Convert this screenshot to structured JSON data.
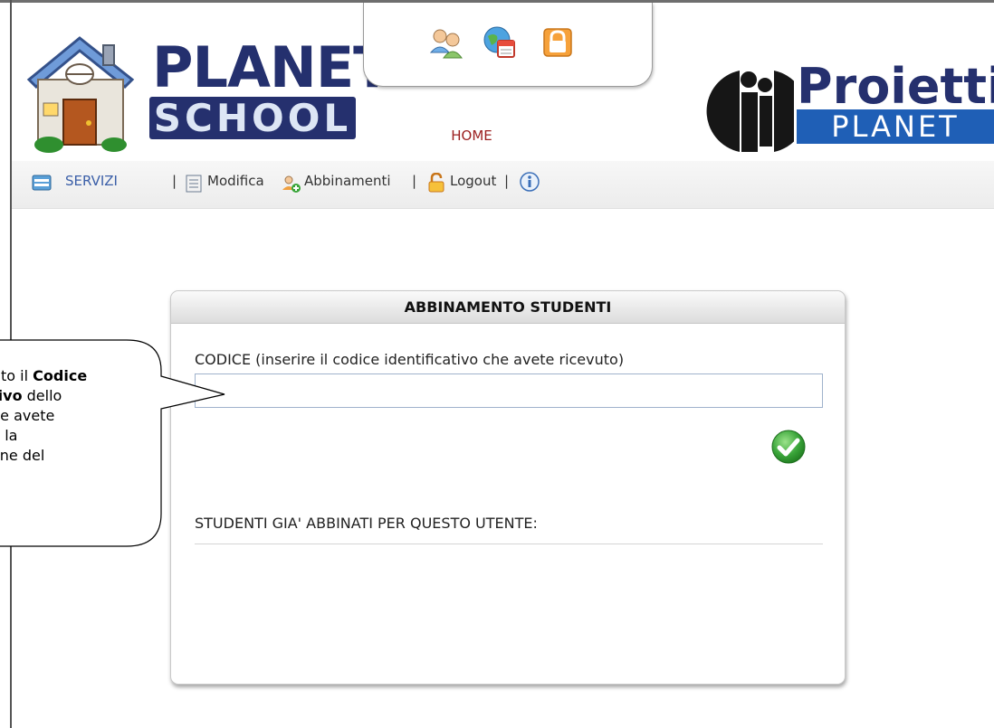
{
  "header": {
    "logo_line1": "PLANET",
    "logo_line2": "SCHOOL",
    "home_label": "HOME",
    "brand_name": "Proietti",
    "brand_sub": "PLANET",
    "top_icons": [
      "users-icon",
      "calendar-globe-icon",
      "lock-icon"
    ]
  },
  "toolbar": {
    "servizi_label": "SERVIZI",
    "sep1": "|",
    "modifica_label": "Modifica",
    "abbinamenti_label": "Abbinamenti",
    "sep2": "|",
    "logout_label": "Logout",
    "sep3": "|"
  },
  "panel": {
    "title": "ABBINAMENTO STUDENTI",
    "code_label": "CODICE (inserire il codice identificativo che avete ricevuto)",
    "code_value": "",
    "associated_label": "STUDENTI GIA' ABBINATI PER QUESTO UTENTE:",
    "associated_items": []
  },
  "callout": {
    "line1_pre": "rito il ",
    "line1_bold": "Codice",
    "line2_bold": "tivo",
    "line2_post": " dello",
    "line3": "he avete",
    "line4": "n la",
    "line5": "one del"
  },
  "colors": {
    "brand_navy": "#25306e",
    "brand_blue": "#1f5fb6",
    "home_red": "#9b1e1e",
    "ok_green": "#3aa53a"
  }
}
